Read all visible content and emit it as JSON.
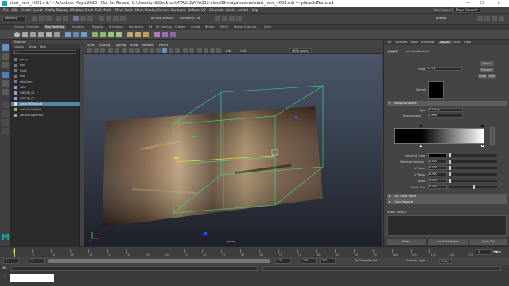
{
  "window": {
    "title": "start_here_v001.mb* - Autodesk Maya 2020 - Not for Resale: C:\\Users\\phil\\Desktop\\MYA312\\MYA312-class09-maya\\scenes\\start_here_v001.mb  ---  place3dTexture1",
    "min": "—",
    "max": "☐",
    "close": "✕"
  },
  "menus": [
    "File",
    "Edit",
    "Create",
    "Select",
    "Modify",
    "Display",
    "Windows",
    "Mesh",
    "Edit Mesh",
    "Mesh Tools",
    "Mesh Display",
    "Curves",
    "Surfaces",
    "Deform",
    "UV",
    "Generate",
    "Cache",
    "Arnold",
    "Help"
  ],
  "menu_right": {
    "workspace_label": "Workspace:",
    "workspace_value": "Maya Classic*"
  },
  "status": {
    "mode": "Modeling",
    "live": "No Live Surface",
    "symmetry": "Symmetry: Off",
    "user": "philzwa"
  },
  "shelf_tabs": [
    "Curves / Surfaces",
    "Poly Modeling",
    "Sculpting",
    "Rigging",
    "Animation",
    "Rendering",
    "FX",
    "FX Caching",
    "Custom",
    "Arnold",
    "Bifrost",
    "MASH",
    "Motion Graphics",
    "XGen"
  ],
  "shelf_active": "Poly Modeling",
  "outliner": {
    "title": "Outliner",
    "menus": [
      "Display",
      "Show",
      "Help"
    ],
    "search_placeholder": "Search...",
    "items": [
      {
        "label": "persp",
        "selected": false
      },
      {
        "label": "top",
        "selected": false
      },
      {
        "label": "front",
        "selected": false
      },
      {
        "label": "side",
        "selected": false
      },
      {
        "label": "shotCam",
        "selected": false
      },
      {
        "label": "GEO",
        "selected": false
      },
      {
        "label": "ORIGIN_01",
        "selected": false
      },
      {
        "label": "ORIGIN_02",
        "selected": false
      },
      {
        "label": "place3dTexture1",
        "selected": true
      },
      {
        "label": "defaultLightSet",
        "selected": false
      },
      {
        "label": "defaultObjectSet",
        "selected": false
      }
    ]
  },
  "viewport": {
    "menus": [
      "View",
      "Shading",
      "Lighting",
      "Show",
      "Renderer",
      "Panels"
    ],
    "camera_label": "persp",
    "color_space": "sRGB gamma",
    "exposure": "0.00",
    "gamma": "1.00"
  },
  "ae": {
    "tabs": [
      "List",
      "Selected",
      "Focus",
      "Attributes",
      "Display",
      "Show",
      "Help"
    ],
    "active_tab": "Display",
    "node_tabs": [
      "ramp1",
      "place2dTexture1"
    ],
    "active_node": "ramp1",
    "ramp_label": "ramp:",
    "ramp_value": "ramp1",
    "sample_label": "Sample",
    "focus_btn": "Focus",
    "presets_btn": "Presets*",
    "show_btn": "Show",
    "hide_btn": "Hide",
    "section_ramp": "Ramp Attributes",
    "type_label": "Type",
    "type_value": "V Ramp",
    "interp_label": "Interpolation",
    "interp_value": "Linear",
    "rows": [
      {
        "label": "Selected Color",
        "value": ""
      },
      {
        "label": "Selected Position",
        "value": "0.000"
      },
      {
        "label": "U Wave",
        "value": "0.000"
      },
      {
        "label": "V Wave",
        "value": "0.000"
      },
      {
        "label": "Noise",
        "value": "0.000"
      },
      {
        "label": "Noise Freq",
        "value": "0.500"
      }
    ],
    "section_hsv": "HSV Color Noise",
    "section_balance": "Color Balance",
    "notes_label": "Notes: ramp1",
    "bottom": [
      "Select",
      "Load Attributes",
      "Copy Tab"
    ]
  },
  "timeline": {
    "ticks": [
      "1",
      "5",
      "10",
      "15",
      "20",
      "25",
      "30",
      "35",
      "40",
      "45",
      "50",
      "55",
      "60",
      "65",
      "70",
      "75",
      "80",
      "85",
      "90",
      "95",
      "100",
      "105",
      "110",
      "115",
      "120"
    ],
    "current": "1",
    "range_start": "1",
    "range_start_inner": "1",
    "range_end_inner": "120",
    "range_end": "120",
    "range_end2": "200",
    "character_set": "No Character Set",
    "anim_layer": "No Anim Layer",
    "fps": "24 fps",
    "frame_field": "1"
  },
  "cmdline": {
    "mel_label": "MEL"
  },
  "colors": {
    "accent": "#5285a6",
    "playhead": "#d9d933",
    "error": "#e04a4a",
    "maya_teal": "#1fa3a3"
  }
}
